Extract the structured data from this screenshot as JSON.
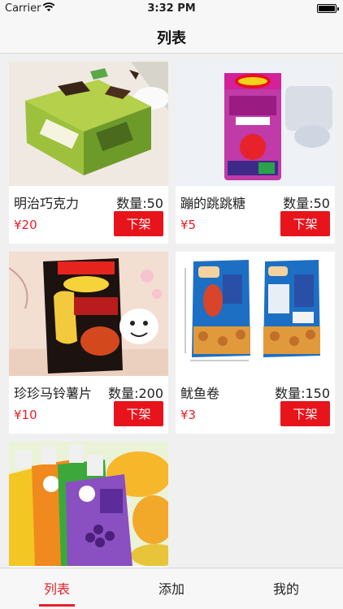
{
  "status_bar": {
    "carrier": "Carrier",
    "time": "3:32 PM"
  },
  "nav": {
    "title": "列表"
  },
  "products": [
    {
      "name": "明治巧克力",
      "quantity": "数量:50",
      "price": "¥20",
      "action": "下架",
      "image_icon": "chocolate-box"
    },
    {
      "name": "蹦的跳跳糖",
      "quantity": "数量:50",
      "price": "¥5",
      "action": "下架",
      "image_icon": "candy-pack"
    },
    {
      "name": "珍珍马铃薯片",
      "quantity": "数量:200",
      "price": "¥10",
      "action": "下架",
      "image_icon": "chips-bag"
    },
    {
      "name": "鱿鱼卷",
      "quantity": "数量:150",
      "price": "¥3",
      "action": "下架",
      "image_icon": "squid-snack-bags"
    },
    {
      "image_icon": "jelly-drink-pouches"
    }
  ],
  "tabs": [
    {
      "label": "列表",
      "active": true
    },
    {
      "label": "添加",
      "active": false
    },
    {
      "label": "我的",
      "active": false
    }
  ],
  "colors": {
    "accent": "#e8202a",
    "button": "#e8141c",
    "background": "#f0f0f0"
  }
}
